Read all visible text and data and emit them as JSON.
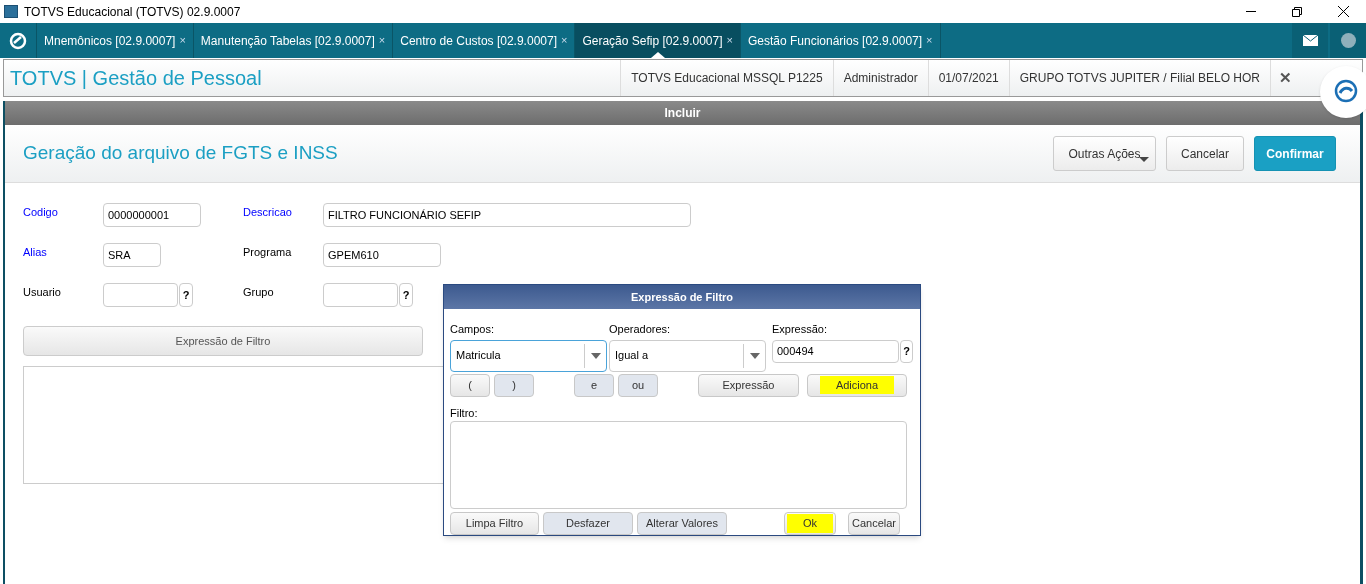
{
  "window": {
    "title": "TOTVS Educacional (TOTVS) 02.9.0007"
  },
  "tabs": [
    {
      "label": "Mnemônicos [02.9.0007]",
      "close": "×",
      "selected": false
    },
    {
      "label": "Manutenção Tabelas [02.9.0007]",
      "close": "×",
      "selected": false
    },
    {
      "label": "Centro de Custos [02.9.0007]",
      "close": "×",
      "selected": false
    },
    {
      "label": "Geração Sefip [02.9.0007]",
      "close": "×",
      "selected": true
    },
    {
      "label": "Gestão Funcionários [02.9.0007]",
      "close": "×",
      "selected": false
    }
  ],
  "header": {
    "title": "TOTVS | Gestão de Pessoal",
    "info": [
      "TOTVS Educacional MSSQL P1225",
      "Administrador",
      "01/07/2021",
      "GRUPO TOTVS JUPITER / Filial BELO HOR"
    ],
    "close": "✕"
  },
  "panel": {
    "caption": "Incluir",
    "title": "Geração do arquivo de FGTS e INSS",
    "actions": [
      {
        "label": "Outras Ações",
        "kind": "menu"
      },
      {
        "label": "Cancelar",
        "kind": "plain"
      },
      {
        "label": "Confirmar",
        "kind": "primary"
      }
    ]
  },
  "form": {
    "rows": [
      [
        {
          "label": "Codigo",
          "required": true,
          "value": "0000000001",
          "kind": "text"
        },
        {
          "label": "Descricao",
          "required": true,
          "value": "FILTRO FUNCIONÁRIO SEFIP",
          "kind": "text"
        }
      ],
      [
        {
          "label": "Alias",
          "required": true,
          "value": "SRA",
          "kind": "text"
        },
        {
          "label": "Programa",
          "required": false,
          "value": "GPEM610",
          "kind": "text"
        }
      ],
      [
        {
          "label": "Usuario",
          "required": false,
          "kind": "lookup",
          "lookup": "?"
        },
        {
          "label": "Grupo",
          "required": false,
          "kind": "lookup",
          "lookup": "?"
        }
      ]
    ],
    "filter_button": "Expressão de Filtro"
  },
  "dialog": {
    "title": "Expressão de Filtro",
    "campos": {
      "label": "Campos:",
      "value": "Matricula",
      "focused": true
    },
    "operadores": {
      "label": "Operadores:",
      "value": "Igual a",
      "focused": false
    },
    "expressao": {
      "label": "Expressão:",
      "value": "000494",
      "lookup": "?"
    },
    "tool_buttons": [
      {
        "label": "(",
        "pressed": false,
        "highlighted": false
      },
      {
        "label": ")",
        "pressed": true,
        "highlighted": false
      },
      {
        "label": "e",
        "pressed": true,
        "highlighted": false
      },
      {
        "label": "ou",
        "pressed": true,
        "highlighted": false
      },
      {
        "label": "Expressão",
        "pressed": false,
        "highlighted": false
      },
      {
        "label": "Adiciona",
        "pressed": false,
        "highlighted": true
      }
    ],
    "filtro_label": "Filtro:",
    "bottom_buttons": [
      {
        "label": "Limpa Filtro",
        "pressed": false,
        "highlighted": false
      },
      {
        "label": "Desfazer",
        "pressed": true,
        "highlighted": false
      },
      {
        "label": "Alterar Valores",
        "pressed": true,
        "highlighted": false
      },
      {
        "label": "Ok",
        "pressed": false,
        "highlighted": true
      },
      {
        "label": "Cancelar",
        "pressed": false,
        "highlighted": false
      }
    ]
  }
}
